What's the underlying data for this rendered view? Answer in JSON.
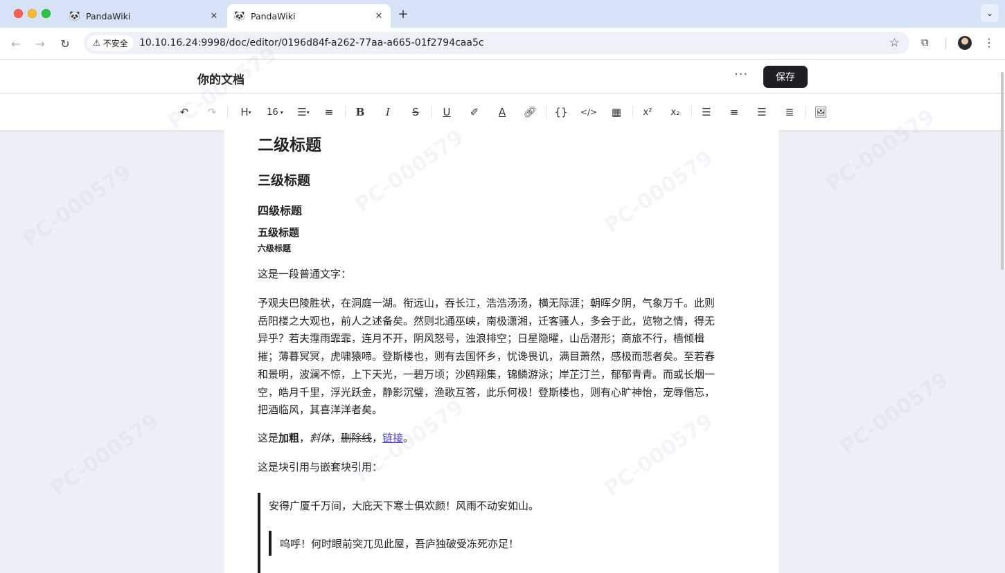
{
  "browser": {
    "tabs": [
      {
        "title": "PandaWiki"
      },
      {
        "title": "PandaWiki"
      }
    ],
    "security_label": "不安全",
    "url": "10.10.16.24:9998/doc/editor/0196d84f-a262-77aa-a665-01f2794caa5c"
  },
  "header": {
    "doc_title": "你的文档",
    "more_label": "···",
    "save_label": "保存"
  },
  "toolbar": {
    "heading_label": "H",
    "font_size": "16"
  },
  "document": {
    "h2": "二级标题",
    "h3": "三级标题",
    "h4": "四级标题",
    "h5": "五级标题",
    "h6": "六级标题",
    "intro": "这是一段普通文字：",
    "paragraph_lines": [
      "予观夫巴陵胜状，在洞庭一湖。衔远山，吞长江，浩浩汤汤，横无际涯；朝晖夕阴，气象万千。此则",
      "岳阳楼之大观也，前人之述备矣。然则北通巫峡，南极潇湘，迁客骚人，多会于此，览物之情，得无",
      "异乎？若夫霪雨霏霏，连月不开，阴风怒号，浊浪排空；日星隐曜，山岳潜形；商旅不行，樯倾楫",
      "摧；薄暮冥冥，虎啸猿啼。登斯楼也，则有去国怀乡，忧谗畏讥，满目萧然，感极而悲者矣。至若春",
      "和景明，波澜不惊，上下天光，一碧万顷；沙鸥翔集，锦鳞游泳；岸芷汀兰，郁郁青青。而或长烟一",
      "空，皓月千里，浮光跃金，静影沉璧，渔歌互答，此乐何极！登斯楼也，则有心旷神怡，宠辱偕忘，",
      "把酒临风，其喜洋洋者矣。"
    ],
    "format_line": {
      "prefix": "这是",
      "bold": "加粗",
      "sep1": "，",
      "italic": "斜体",
      "sep2": "，",
      "strike": "删除线",
      "sep3": "，",
      "link": "链接",
      "end": "。"
    },
    "quote_intro": "这是块引用与嵌套块引用：",
    "quote1": "安得广厦千万间，大庇天下寒士俱欢颜！风雨不动安如山。",
    "quote2": "呜呼！何时眼前突兀见此屋，吾庐独破受冻死亦足！"
  },
  "watermark": "PC-000579"
}
